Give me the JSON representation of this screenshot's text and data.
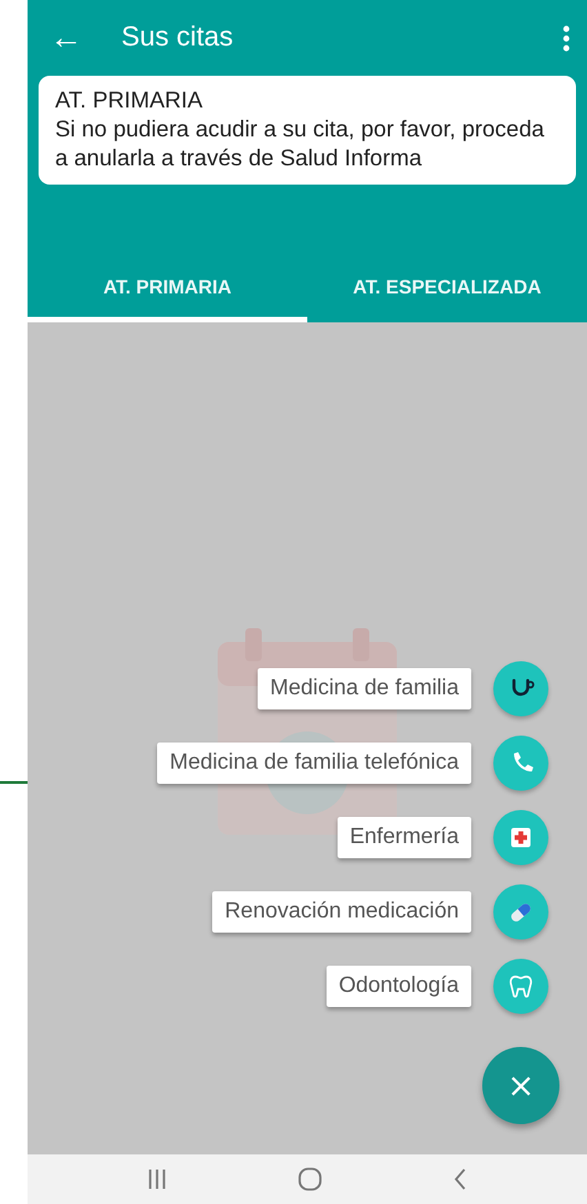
{
  "app_bar": {
    "back_icon": "←",
    "title": "Sus citas"
  },
  "notice": {
    "title": "AT. PRIMARIA",
    "message": "Si no pudiera acudir a su cita, por favor, proceda a anularla a través de Salud Informa"
  },
  "tabs": [
    {
      "label": "AT. PRIMARIA",
      "selected": true
    },
    {
      "label": "AT. ESPECIALIZADA",
      "selected": false
    }
  ],
  "speed_dial": {
    "expanded": true,
    "close_icon": "×",
    "actions": [
      {
        "label": "Medicina de familia",
        "kind": "stethoscope"
      },
      {
        "label": "Medicina de familia telefónica",
        "kind": "phone"
      },
      {
        "label": "Enfermería",
        "kind": "firstaid"
      },
      {
        "label": "Renovación medicación",
        "kind": "pill"
      },
      {
        "label": "Odontología",
        "kind": "tooth"
      }
    ]
  }
}
